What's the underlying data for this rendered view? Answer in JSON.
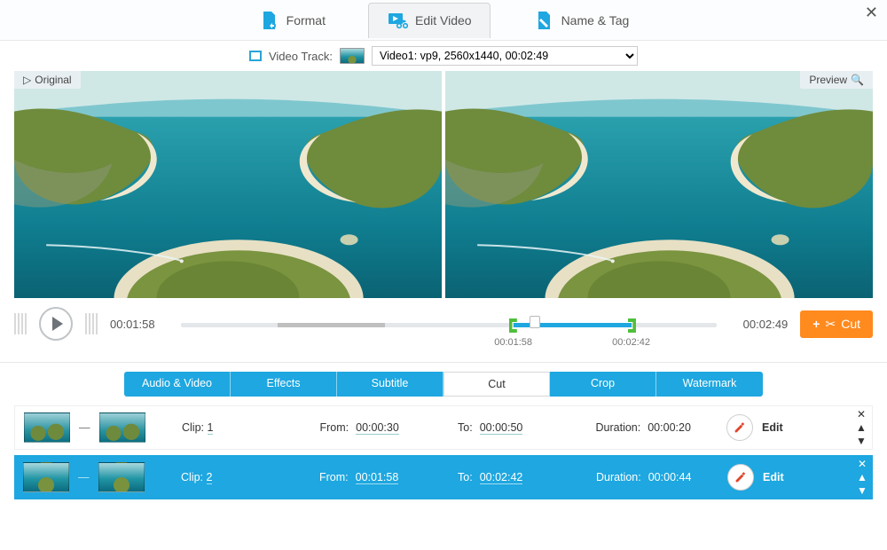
{
  "topnav": {
    "format": "Format",
    "edit_video": "Edit Video",
    "name_tag": "Name & Tag"
  },
  "track": {
    "label": "Video Track:",
    "selected": "Video1: vp9, 2560x1440, 00:02:49"
  },
  "preview_labels": {
    "original": "Original",
    "preview": "Preview"
  },
  "player": {
    "pos": "00:01:58",
    "total": "00:02:49",
    "sel_start": "00:01:58",
    "sel_end": "00:02:42",
    "cut_btn": "Cut"
  },
  "subtabs": {
    "audio_video": "Audio & Video",
    "effects": "Effects",
    "subtitle": "Subtitle",
    "cut": "Cut",
    "crop": "Crop",
    "watermark": "Watermark",
    "active": "cut"
  },
  "labels": {
    "clip": "Clip:",
    "from": "From:",
    "to": "To:",
    "duration": "Duration:",
    "edit": "Edit"
  },
  "clips": [
    {
      "n": "1",
      "from": "00:00:30",
      "to": "00:00:50",
      "dur": "00:00:20"
    },
    {
      "n": "2",
      "from": "00:01:58",
      "to": "00:02:42",
      "dur": "00:00:44"
    }
  ]
}
